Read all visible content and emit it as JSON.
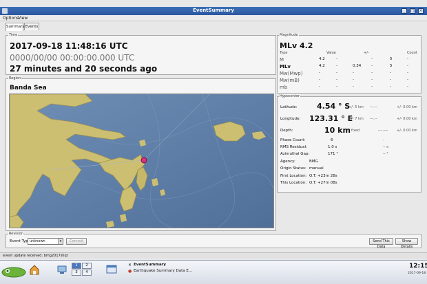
{
  "window": {
    "title": "EventSummary"
  },
  "menu": {
    "items": [
      "Options",
      "View"
    ]
  },
  "tabs": [
    {
      "label": "Summary"
    },
    {
      "label": "Events"
    }
  ],
  "time": {
    "group_label": "Time",
    "origin_time": "2017-09-18   11:48:16 UTC",
    "null_time": "0000/00/00   00:00:00.000 UTC",
    "elapsed": "27 minutes and 20 seconds ago"
  },
  "region": {
    "group_label": "Region",
    "name": "Banda Sea"
  },
  "magnitude": {
    "group_label": "Magnitude",
    "main": "MLv  4.2",
    "headers": {
      "type": "Type",
      "value": "Value",
      "pm": "+/-",
      "count": "Count"
    },
    "rows": [
      {
        "type": "M",
        "value": "4.2",
        "d1": "-",
        "pm": "",
        "d2": "-",
        "count": "5",
        "d3": "-",
        "bold": false
      },
      {
        "type": "MLv",
        "value": "4.2",
        "d1": "-",
        "pm": "0.34",
        "d2": "-",
        "count": "5",
        "d3": "-",
        "bold": true
      },
      {
        "type": "Mw(Mwp)",
        "value": "-",
        "d1": "-",
        "pm": "-",
        "d2": "-",
        "count": "-",
        "d3": "-",
        "bold": false
      },
      {
        "type": "Mw(mB)",
        "value": "-",
        "d1": "-",
        "pm": "-",
        "d2": "-",
        "count": "-",
        "d3": "-",
        "bold": false
      },
      {
        "type": "mb",
        "value": "-",
        "d1": "-",
        "pm": "-",
        "d2": "-",
        "count": "-",
        "d3": "-",
        "bold": false
      }
    ]
  },
  "hypocenter": {
    "group_label": "Hypocenter",
    "latitude": {
      "label": "Latitude:",
      "value": "4.54 ° S",
      "err": "+/-  5 km",
      "secondary": "---.--",
      "err2": "+/-  0.00 km"
    },
    "longitude": {
      "label": "Longitude:",
      "value": "123.31 ° E",
      "err": "+/-  7 km",
      "secondary": "---.--",
      "err2": "+/-  0.00 km"
    },
    "depth": {
      "label": "Depth:",
      "value": "10 km",
      "err": "fixed",
      "secondary": "--- ----",
      "err2": "+/-  0.00 km"
    },
    "phase_count": {
      "label": "Phase Count:",
      "value": "6",
      "secondary": "-"
    },
    "rms": {
      "label": "RMS Residual:",
      "value": "1.0  s",
      "secondary": "--  s"
    },
    "gap": {
      "label": "Azimuthal Gap:",
      "value": "171  °",
      "secondary": "--  °"
    },
    "agency": {
      "label": "Agency:",
      "value": "BMG"
    },
    "origin_status": {
      "label": "Origin Status:",
      "value": "manual"
    },
    "first_location": {
      "label": "First Location:",
      "value": "O.T. +23m 28s"
    },
    "this_location": {
      "label": "This Location:",
      "value": "O.T. +27m 08s"
    }
  },
  "revision": {
    "group_label": "Revision",
    "event_type_label": "Event Type:",
    "event_type_value": "unknown",
    "commit_label": "Commit",
    "send_button": "Send This Data",
    "show_details_button": "Show Details"
  },
  "status": {
    "text": "event update received: bmg2017shqt"
  },
  "taskbar": {
    "workspaces": [
      "1",
      "2",
      "3",
      "4"
    ],
    "window_title": "EventSummary",
    "window_subtitle": "Earthquake Summary Data E...",
    "clock": "12:15",
    "date": "2017-09-18"
  },
  "colors": {
    "titlebar": "#2b58a0",
    "sea": "#5d7fa8",
    "land": "#cdbf72",
    "marker": "#d6337a"
  }
}
